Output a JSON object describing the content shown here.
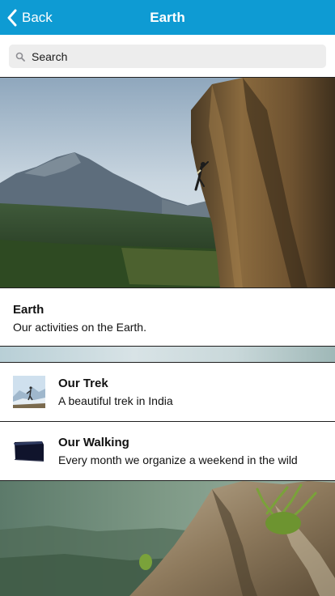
{
  "navbar": {
    "back_label": "Back",
    "title": "Earth",
    "background_color": "#0e9bd3",
    "back_icon": "chevron-left-icon"
  },
  "search": {
    "placeholder": "Search",
    "icon": "search-icon"
  },
  "hero": {
    "description_icon": "rock-climber-photo"
  },
  "section": {
    "title": "Earth",
    "subtitle": "Our activities on the Earth."
  },
  "items": [
    {
      "title": "Our Trek",
      "subtitle": "A beautiful trek in India",
      "thumbnail": "trek-photo"
    },
    {
      "title": "Our Walking",
      "subtitle": "Every month we organize a weekend in the wild",
      "thumbnail": "folder-photo"
    }
  ]
}
